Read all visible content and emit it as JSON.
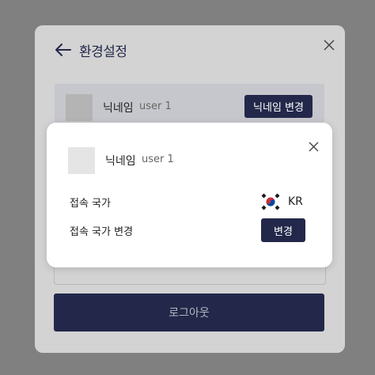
{
  "settings": {
    "title": "환경설정",
    "nickname_label": "닉네임",
    "user_id": "user 1",
    "change_nickname_label": "닉네임 변경",
    "logout_label": "로그아웃"
  },
  "modal": {
    "nickname_label": "닉네임",
    "user_id": "user 1",
    "connection_country_label": "접속 국가",
    "country_code": "KR",
    "country_flag_icon": "south-korea-flag-icon",
    "change_country_label": "접속 국가 변경",
    "change_button_label": "변경"
  },
  "colors": {
    "overlay": "#808080",
    "panel": "#d3d3d3",
    "accent_navy": "#23284a",
    "modal_bg": "#ffffff"
  }
}
